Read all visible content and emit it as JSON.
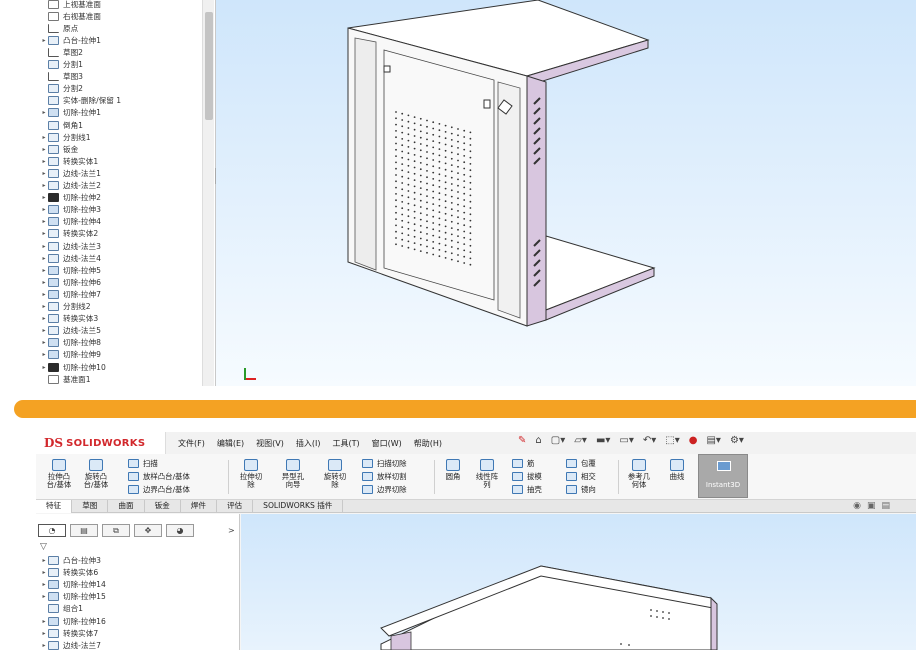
{
  "top_tree": {
    "items": [
      {
        "arrow": "",
        "label": "上视基准面",
        "icon": "plane-icon"
      },
      {
        "arrow": "",
        "label": "右视基准面",
        "icon": "plane-icon"
      },
      {
        "arrow": "",
        "label": "原点",
        "icon": "origin-icon"
      },
      {
        "arrow": "▸",
        "label": "凸台-拉伸1",
        "icon": "extrude-icon"
      },
      {
        "arrow": "",
        "label": "草图2",
        "icon": "sketch-icon"
      },
      {
        "arrow": "",
        "label": "分割1",
        "icon": "split-icon"
      },
      {
        "arrow": "",
        "label": "草图3",
        "icon": "sketch-icon"
      },
      {
        "arrow": "",
        "label": "分割2",
        "icon": "split-icon"
      },
      {
        "arrow": "",
        "label": "实体-删除/保留 1",
        "icon": "body-delete-icon"
      },
      {
        "arrow": "▸",
        "label": "切除-拉伸1",
        "icon": "cut-extrude-icon"
      },
      {
        "arrow": "",
        "label": "倒角1",
        "icon": "chamfer-icon"
      },
      {
        "arrow": "▸",
        "label": "分割线1",
        "icon": "split-line-icon"
      },
      {
        "arrow": "▸",
        "label": "钣金",
        "icon": "sheet-metal-icon"
      },
      {
        "arrow": "▸",
        "label": "转换实体1",
        "icon": "convert-icon"
      },
      {
        "arrow": "▸",
        "label": "边线-法兰1",
        "icon": "edge-flange-icon"
      },
      {
        "arrow": "▸",
        "label": "边线-法兰2",
        "icon": "edge-flange-icon"
      },
      {
        "arrow": "▸",
        "label": "切除-拉伸2",
        "icon": "cut-extrude-dark-icon"
      },
      {
        "arrow": "▸",
        "label": "切除-拉伸3",
        "icon": "cut-extrude-icon"
      },
      {
        "arrow": "▸",
        "label": "切除-拉伸4",
        "icon": "cut-extrude-icon"
      },
      {
        "arrow": "▸",
        "label": "转换实体2",
        "icon": "convert-icon"
      },
      {
        "arrow": "▸",
        "label": "边线-法兰3",
        "icon": "edge-flange-icon"
      },
      {
        "arrow": "▸",
        "label": "边线-法兰4",
        "icon": "edge-flange-icon"
      },
      {
        "arrow": "▸",
        "label": "切除-拉伸5",
        "icon": "cut-extrude-icon"
      },
      {
        "arrow": "▸",
        "label": "切除-拉伸6",
        "icon": "cut-extrude-icon"
      },
      {
        "arrow": "▸",
        "label": "切除-拉伸7",
        "icon": "cut-extrude-icon"
      },
      {
        "arrow": "▸",
        "label": "分割线2",
        "icon": "split-line-icon"
      },
      {
        "arrow": "▸",
        "label": "转换实体3",
        "icon": "convert-icon"
      },
      {
        "arrow": "▸",
        "label": "边线-法兰5",
        "icon": "edge-flange-icon"
      },
      {
        "arrow": "▸",
        "label": "切除-拉伸8",
        "icon": "cut-extrude-icon"
      },
      {
        "arrow": "▸",
        "label": "切除-拉伸9",
        "icon": "cut-extrude-icon"
      },
      {
        "arrow": "▸",
        "label": "切除-拉伸10",
        "icon": "cut-extrude-dark-icon"
      },
      {
        "arrow": "",
        "label": "基准面1",
        "icon": "plane-icon"
      }
    ]
  },
  "bottom": {
    "brand": "SOLIDWORKS",
    "brand_mark": "DS",
    "menu": [
      "文件(F)",
      "编辑(E)",
      "视图(V)",
      "插入(I)",
      "工具(T)",
      "窗口(W)",
      "帮助(H)"
    ],
    "ribbon": {
      "extrude_boss": "拉伸凸\n台/基体",
      "revolve_boss": "旋转凸\n台/基体",
      "sweep": "扫描",
      "loft": "放样凸台/基体",
      "boundary_boss": "边界凸台/基体",
      "extrude_cut": "拉伸切\n除",
      "hole_wizard": "异型孔\n向导",
      "revolve_cut": "旋转切\n除",
      "swept_cut": "扫描切除",
      "lofted_cut": "放样切割",
      "boundary_cut": "边界切除",
      "fillet": "圆角",
      "linear_pattern": "线性阵\n列",
      "rib": "筋",
      "draft": "拔模",
      "shell": "抽壳",
      "wrap": "包覆",
      "intersect": "相交",
      "mirror": "镜向",
      "ref_geometry": "参考几\n何体",
      "curves": "曲线",
      "instant3d": "Instant3D"
    },
    "tabs": [
      "特征",
      "草图",
      "曲面",
      "钣金",
      "焊件",
      "评估",
      "SOLIDWORKS 插件"
    ],
    "active_tab": "特征",
    "tree": [
      {
        "arrow": "▸",
        "label": "凸台-拉伸3",
        "icon": "extrude-icon"
      },
      {
        "arrow": "▸",
        "label": "转换实体6",
        "icon": "convert-icon"
      },
      {
        "arrow": "▸",
        "label": "切除-拉伸14",
        "icon": "cut-extrude-icon"
      },
      {
        "arrow": "▸",
        "label": "切除-拉伸15",
        "icon": "cut-extrude-icon"
      },
      {
        "arrow": "",
        "label": "组合1",
        "icon": "combine-icon"
      },
      {
        "arrow": "▸",
        "label": "切除-拉伸16",
        "icon": "cut-extrude-icon"
      },
      {
        "arrow": "▸",
        "label": "转换实体7",
        "icon": "convert-icon"
      },
      {
        "arrow": "▸",
        "label": "边线-法兰7",
        "icon": "edge-flange-icon"
      }
    ]
  },
  "colors": {
    "divider": "#f4a223",
    "viewport_top": "#cfe6fb",
    "model_side": "#d8c8de",
    "brand_red": "#d2282c"
  }
}
